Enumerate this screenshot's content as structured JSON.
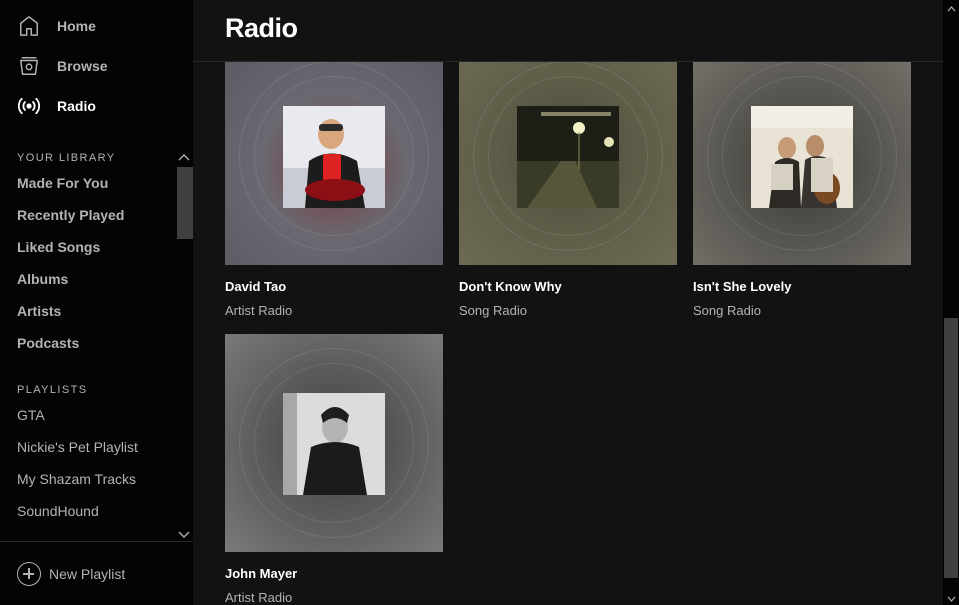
{
  "sidebar": {
    "nav": [
      {
        "label": "Home",
        "icon": "home-icon"
      },
      {
        "label": "Browse",
        "icon": "browse-icon"
      },
      {
        "label": "Radio",
        "icon": "radio-icon"
      }
    ],
    "library_title": "YOUR LIBRARY",
    "library": [
      "Made For You",
      "Recently Played",
      "Liked Songs",
      "Albums",
      "Artists",
      "Podcasts"
    ],
    "playlists_title": "PLAYLISTS",
    "playlists": [
      "GTA",
      "Nickie's Pet Playlist",
      "My Shazam Tracks",
      "SoundHound"
    ],
    "new_playlist": "New Playlist"
  },
  "main": {
    "title": "Radio",
    "cards": [
      {
        "name": "David Tao",
        "sub": "Artist Radio",
        "bg": "#6a6870"
      },
      {
        "name": "Don't Know Why",
        "sub": "Song Radio",
        "bg": "#5b5a45"
      },
      {
        "name": "Isn't She Lovely",
        "sub": "Song Radio",
        "bg": "#5e5b56"
      },
      {
        "name": "John Mayer",
        "sub": "Artist Radio",
        "bg": "#6a6a6a"
      }
    ]
  },
  "colors": {
    "sidebar_bg": "#040404",
    "main_bg": "#121212",
    "text_muted": "#b3b3b3",
    "text_active": "#ffffff"
  }
}
